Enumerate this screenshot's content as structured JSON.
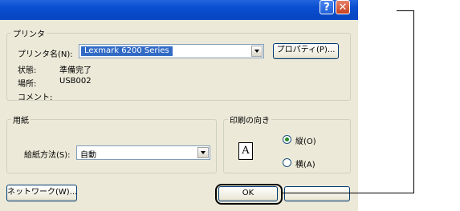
{
  "title_bar": {
    "help_label": "?",
    "close_label": "✕",
    "help_icon": "question-icon",
    "close_icon": "close-icon"
  },
  "printer": {
    "group_label": "プリンタ",
    "name_label": "プリンタ名(N):",
    "name_value": "Lexmark 6200 Series",
    "properties_button": "プロパティ(P)...",
    "status_label": "状態:",
    "status_value": "準備完了",
    "location_label": "場所:",
    "location_value": "USB002",
    "comment_label": "コメント:"
  },
  "paper": {
    "group_label": "用紙",
    "source_label": "給紙方法(S):",
    "source_value": "自動"
  },
  "orientation": {
    "group_label": "印刷の向き",
    "portrait_label": "縦(O)",
    "landscape_label": "横(A)",
    "selected": "portrait",
    "icon_letter": "A"
  },
  "footer": {
    "network_button": "ネットワーク(W)...",
    "ok_button": "OK"
  }
}
